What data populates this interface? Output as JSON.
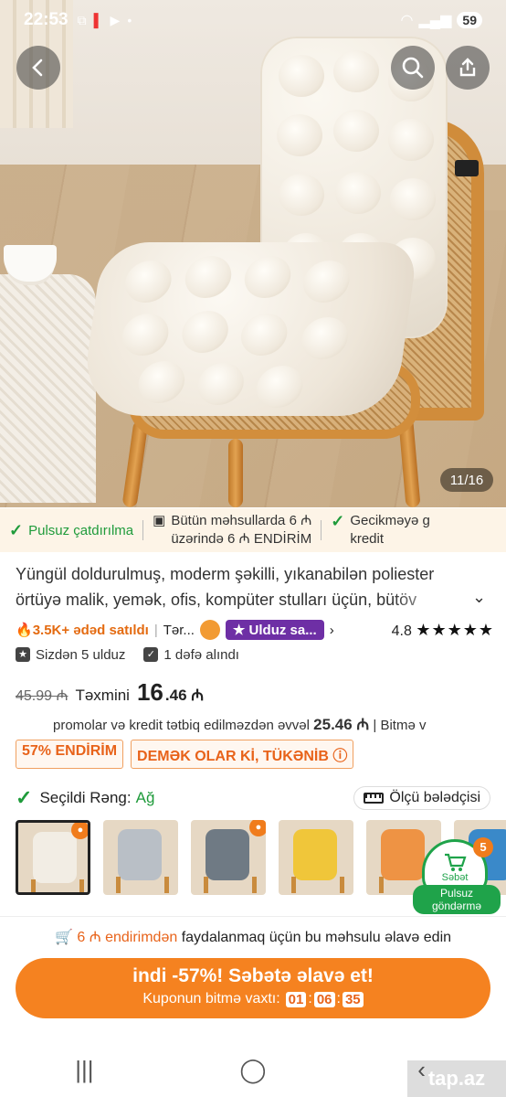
{
  "status_bar": {
    "time": "22:53",
    "battery": "59"
  },
  "gallery": {
    "counter": "11/16"
  },
  "benefits": {
    "free_shipping": "Pulsuz çatdırılma",
    "discount_line1": "Bütün məhsullarda 6 ₼",
    "discount_line2": "üzərində 6 ₼ ENDİRİM",
    "late_line1": "Gecikməyə g",
    "late_line2": "kredit"
  },
  "product": {
    "title": "Yüngül doldurulmuş, moderm şəkilli, yıkanabilən poliester örtüyə malik, yemək, ofis, kompüter stulları üçün, bütöv",
    "sold": "3.5K+ ədəd satıldı",
    "store": "Tər...",
    "stars_badge": "Ulduz sa...",
    "rating": "4.8",
    "stars": "★★★★★",
    "from_you": "Sizdən 5 ulduz",
    "bought": "1 dəfə alındı"
  },
  "price": {
    "old": "45.99 ₼",
    "est_label": "Təxmini",
    "main_int": "16",
    "main_dec": ".46 ₼",
    "promo_text": "promolar və kredit tətbiq edilməzdən əvvəl",
    "promo_price": "25.46 ₼",
    "promo_tail": "| Bitmə v"
  },
  "badges": {
    "discount": "57% ENDİRİM",
    "almost_gone": "DEMƏK OLAR Kİ, TÜKƏNİB"
  },
  "variant": {
    "label": "Seçildi Rəng:",
    "value": "Ağ",
    "size_guide": "Ölçü bələdçisi"
  },
  "thumbs": [
    "#f2ede4",
    "#b9bfc6",
    "#6f7a84",
    "#f0c63a",
    "#ee9344",
    "#3a89c9"
  ],
  "cart": {
    "count": "5",
    "label": "Səbət",
    "free1": "Pulsuz",
    "free2": "göndərmə"
  },
  "addon": {
    "amount": "6 ₼ endirimdən",
    "text": "faydalanmaq üçün bu məhsulu əlavə edin"
  },
  "cta": {
    "main": "indi -57%! Səbətə əlavə et!",
    "timer_label": "Kuponun bitmə vaxtı:",
    "hh": "01",
    "mm": "06",
    "ss": "35"
  },
  "watermark": "tap.az"
}
